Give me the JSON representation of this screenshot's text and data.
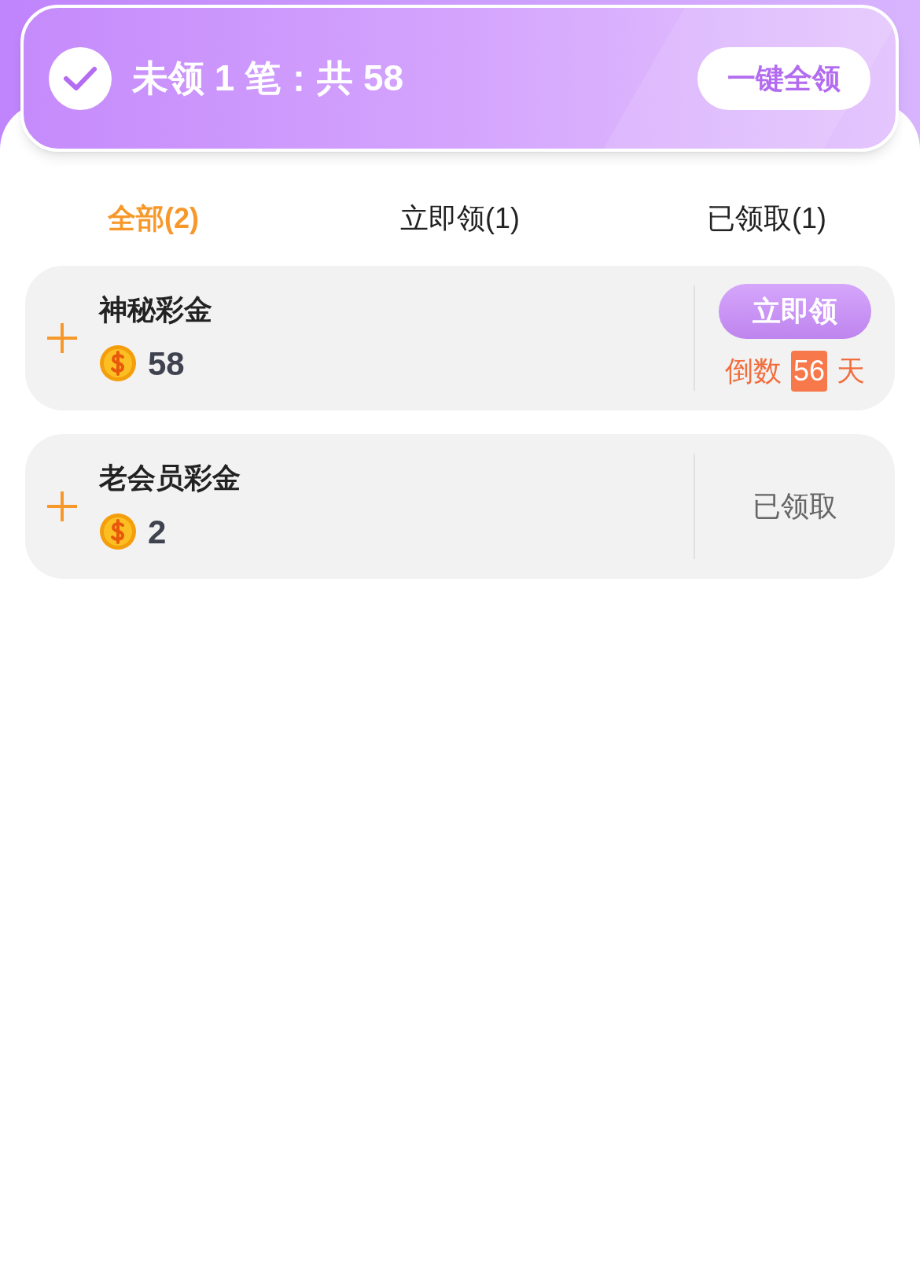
{
  "header": {
    "checked": true,
    "summary": "未领 1 笔：共 58",
    "claim_all_button": "一键全领"
  },
  "tabs": [
    {
      "label": "全部(2)",
      "selected": true
    },
    {
      "label": "立即领(1)",
      "selected": false
    },
    {
      "label": "已领取(1)",
      "selected": false
    }
  ],
  "rewards": [
    {
      "kind": "claimable",
      "title": "神秘彩金",
      "amount": "58",
      "action": "立即领",
      "countdown": {
        "prefix": "倒数",
        "days": "56",
        "suffix": "天"
      }
    },
    {
      "kind": "claimed",
      "title": "老会员彩金",
      "amount": "2",
      "status": "已领取"
    }
  ]
}
